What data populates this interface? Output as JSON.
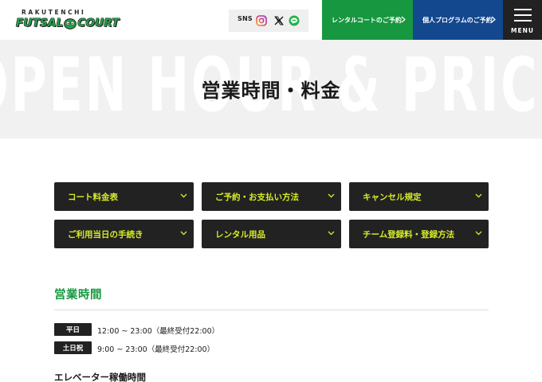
{
  "header": {
    "logo_top": "RAKUTENCHI",
    "logo_left": "FUTSAL",
    "logo_right": "COURT",
    "sns_label": "SNS",
    "sns_icons": [
      "instagram-icon",
      "x-icon",
      "line-icon"
    ],
    "cta_rental": "レンタルコートのご予約",
    "cta_program": "個人プログラムのご予約",
    "menu_label": "MENU",
    "colors": {
      "green": "#17973f",
      "blue": "#13478e",
      "dark": "#222222",
      "accent": "#d7eb2a"
    }
  },
  "hero": {
    "bg_text": "OPEN HOUR & PRICE",
    "title": "営業時間・料金"
  },
  "anchors": [
    {
      "label": "コート料金表"
    },
    {
      "label": "ご予約・お支払い方法"
    },
    {
      "label": "キャンセル規定"
    },
    {
      "label": "ご利用当日の手続き"
    },
    {
      "label": "レンタル用品"
    },
    {
      "label": "チーム登録料・登録方法"
    }
  ],
  "hours": {
    "title": "営業時間",
    "rows": [
      {
        "day": "平日",
        "time": "12:00 ~ 23:00（最終受付22:00）"
      },
      {
        "day": "土日祝",
        "time": "9:00 ~ 23:00（最終受付22:00）"
      }
    ],
    "elevator_title": "エレベーター稼働時間"
  }
}
